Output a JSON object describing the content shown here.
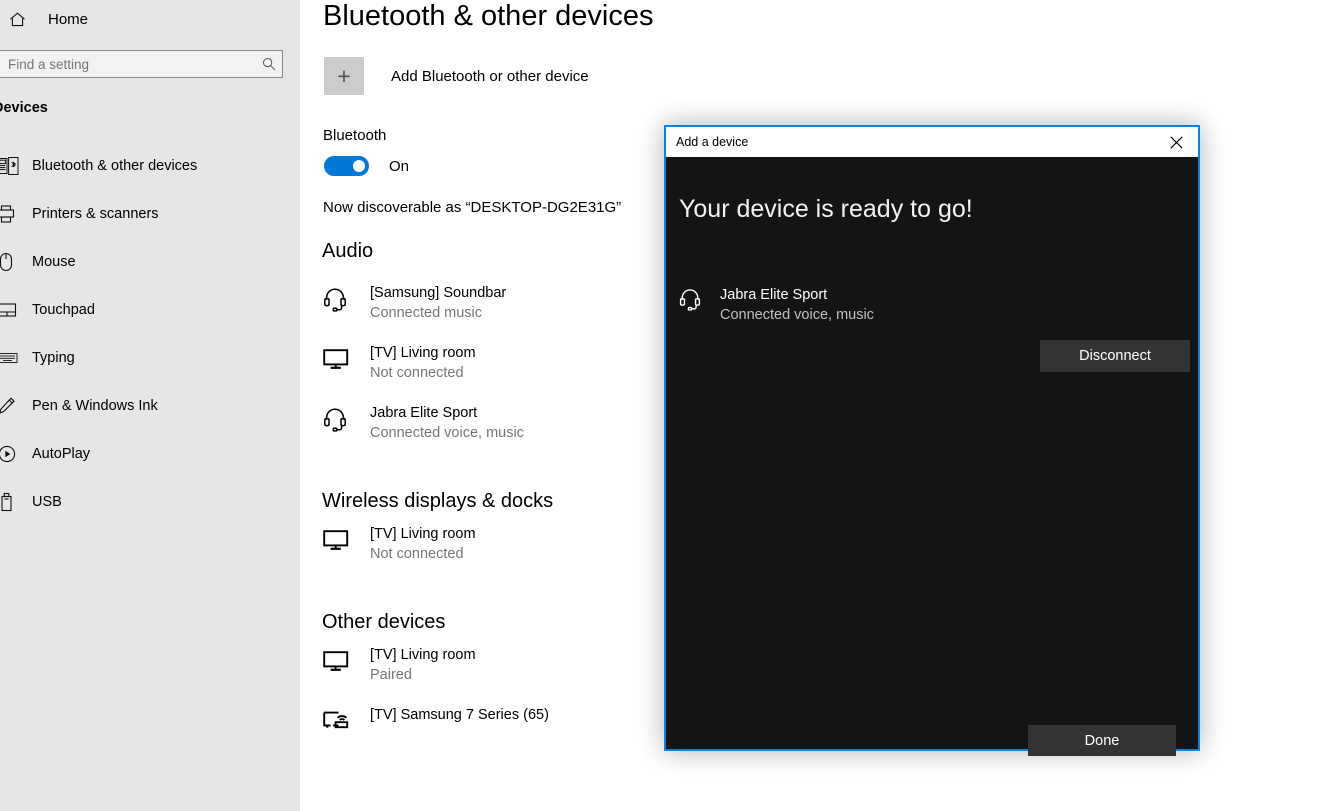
{
  "sidebar": {
    "home_label": "Home",
    "search": {
      "value": "",
      "placeholder": "Find a setting"
    },
    "section_label": "Devices",
    "items": [
      {
        "label": "Bluetooth & other devices",
        "icon": "bluetooth-devices-icon"
      },
      {
        "label": "Printers & scanners",
        "icon": "printer-icon"
      },
      {
        "label": "Mouse",
        "icon": "mouse-icon"
      },
      {
        "label": "Touchpad",
        "icon": "touchpad-icon"
      },
      {
        "label": "Typing",
        "icon": "keyboard-icon"
      },
      {
        "label": "Pen & Windows Ink",
        "icon": "pen-icon"
      },
      {
        "label": "AutoPlay",
        "icon": "autoplay-icon"
      },
      {
        "label": "USB",
        "icon": "usb-icon"
      }
    ]
  },
  "main": {
    "title": "Bluetooth & other devices",
    "add_device_label": "Add Bluetooth or other device",
    "bluetooth_label": "Bluetooth",
    "bluetooth_toggle_state": "On",
    "discoverable_text": "Now discoverable as “DESKTOP-DG2E31G”",
    "accent_color": "#0078d7",
    "groups": [
      {
        "heading": "Audio",
        "devices": [
          {
            "name": "[Samsung] Soundbar",
            "status": "Connected music",
            "icon": "headset-icon"
          },
          {
            "name": "[TV] Living room",
            "status": "Not connected",
            "icon": "monitor-icon"
          },
          {
            "name": "Jabra Elite Sport",
            "status": "Connected voice, music",
            "icon": "headset-icon"
          }
        ]
      },
      {
        "heading": "Wireless displays & docks",
        "devices": [
          {
            "name": "[TV] Living room",
            "status": "Not connected",
            "icon": "monitor-icon"
          }
        ]
      },
      {
        "heading": "Other devices",
        "devices": [
          {
            "name": "[TV] Living room",
            "status": "Paired",
            "icon": "monitor-icon"
          },
          {
            "name": "[TV] Samsung 7 Series (65)",
            "status": "",
            "icon": "wireless-display-icon"
          }
        ]
      }
    ]
  },
  "dialog": {
    "title": "Add a device",
    "close_icon": "close-icon",
    "heading": "Your device is ready to go!",
    "device": {
      "name": "Jabra Elite Sport",
      "status": "Connected voice, music",
      "icon": "headset-icon"
    },
    "disconnect_label": "Disconnect",
    "done_label": "Done",
    "border_color": "#0a84e0",
    "background_color": "#141414"
  }
}
